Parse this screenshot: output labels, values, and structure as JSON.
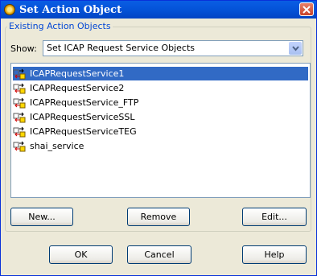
{
  "window": {
    "title": "Set Action Object"
  },
  "group": {
    "label": "Existing Action Objects"
  },
  "show": {
    "label": "Show:",
    "selected": "Set ICAP Request Service Objects"
  },
  "list": {
    "items": [
      {
        "label": "ICAPRequestService1",
        "selected": true
      },
      {
        "label": "ICAPRequestService2",
        "selected": false
      },
      {
        "label": "ICAPRequestService_FTP",
        "selected": false
      },
      {
        "label": "ICAPRequestServiceSSL",
        "selected": false
      },
      {
        "label": "ICAPRequestServiceTEG",
        "selected": false
      },
      {
        "label": "shai_service",
        "selected": false
      }
    ]
  },
  "buttons": {
    "new": "New...",
    "remove": "Remove",
    "edit": "Edit...",
    "ok": "OK",
    "cancel": "Cancel",
    "help": "Help"
  },
  "colors": {
    "titlebar": "#0453d8",
    "selection": "#316ac5",
    "group_label": "#0046d5",
    "dialog_bg": "#ece9d8"
  }
}
